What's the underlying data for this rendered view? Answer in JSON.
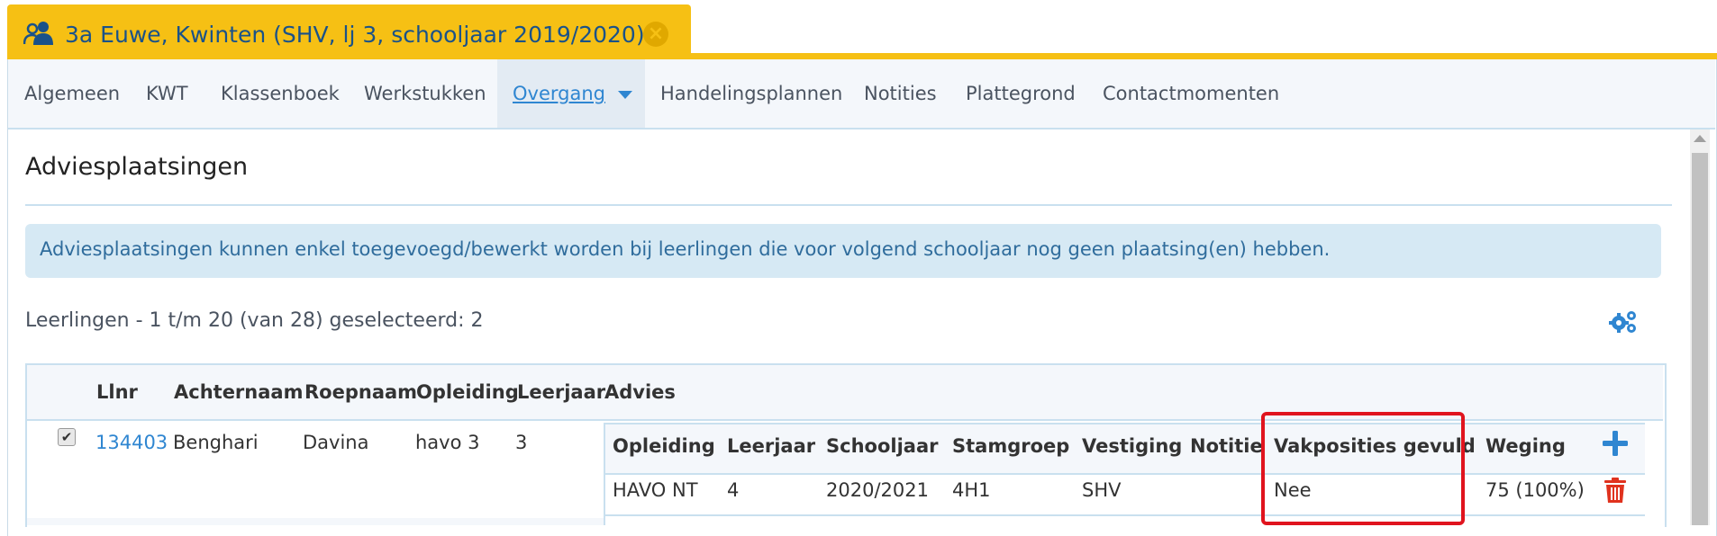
{
  "tab": {
    "title": "3a Euwe, Kwinten (SHV, lj 3, schooljaar 2019/2020)",
    "icon": "users-icon",
    "close_icon": "close-icon",
    "accent": "#f6c014"
  },
  "nav": {
    "items": [
      {
        "label": "Algemeen",
        "active": false
      },
      {
        "label": "KWT",
        "active": false
      },
      {
        "label": "Klassenboek",
        "active": false
      },
      {
        "label": "Werkstukken",
        "active": false
      },
      {
        "label": "Overgang",
        "active": true
      },
      {
        "label": "Handelingsplannen",
        "active": false
      },
      {
        "label": "Notities",
        "active": false
      },
      {
        "label": "Plattegrond",
        "active": false
      },
      {
        "label": "Contactmomenten",
        "active": false
      }
    ]
  },
  "main": {
    "heading": "Adviesplaatsingen",
    "info": "Adviesplaatsingen kunnen enkel toegevoegd/bewerkt worden bij leerlingen die voor volgend schooljaar nog geen plaatsing(en) hebben.",
    "count": "Leerlingen - 1 t/m 20 (van 28) geselecteerd: 2",
    "settings_icon": "gears-icon"
  },
  "table": {
    "headers": [
      "Llnr",
      "Achternaam",
      "Roepnaam",
      "Opleiding",
      "Leerjaar",
      "Advies"
    ],
    "rows": [
      {
        "checked": true,
        "llnr": "134403",
        "achternaam": "Benghari",
        "roepnaam": "Davina",
        "opleiding": "havo 3",
        "leerjaar": "3"
      }
    ],
    "advies": {
      "headers": [
        "Opleiding",
        "Leerjaar",
        "Schooljaar",
        "Stamgroep",
        "Vestiging",
        "Notitie",
        "Vakposities gevuld",
        "Weging"
      ],
      "row": {
        "opleiding": "HAVO NT",
        "leerjaar": "4",
        "schooljaar": "2020/2021",
        "stamgroep": "4H1",
        "vestiging": "SHV",
        "notitie": "",
        "vakposities": "Nee",
        "weging": "75 (100%)"
      },
      "add_icon": "plus-icon",
      "delete_icon": "trash-icon"
    }
  },
  "colors": {
    "link": "#2f86d1",
    "highlight": "#e0141e",
    "delete": "#e0321e"
  }
}
